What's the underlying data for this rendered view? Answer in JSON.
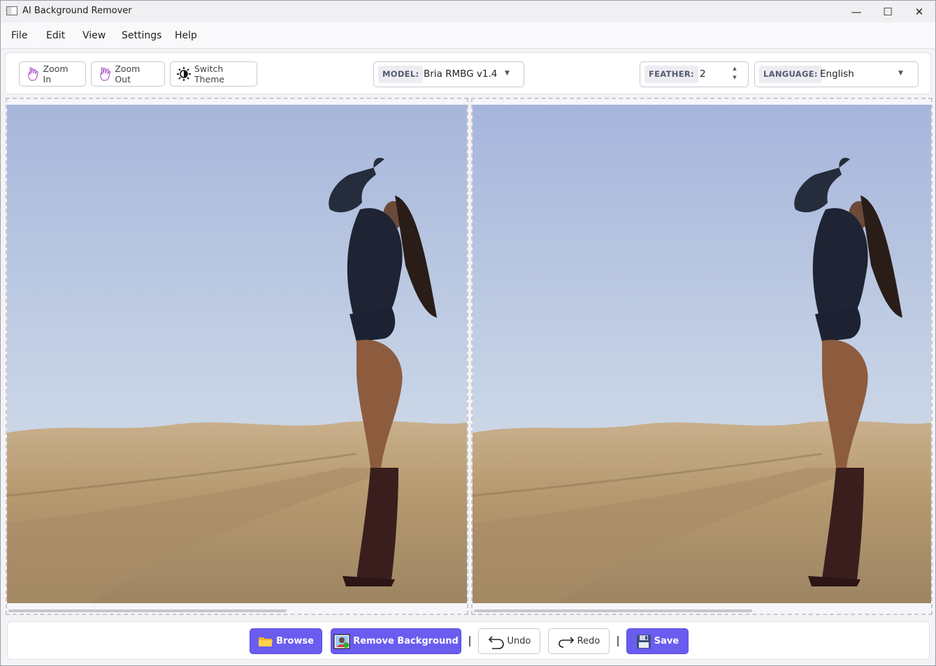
{
  "window": {
    "title": "AI Background Remover",
    "controls": {
      "minimize": "—",
      "maximize": "☐",
      "close": "✕"
    }
  },
  "menu": [
    "File",
    "Edit",
    "View",
    "Settings",
    "Help"
  ],
  "toolbar": {
    "zoom_in": "Zoom In",
    "zoom_out": "Zoom Out",
    "switch_theme": "Switch Theme",
    "model": {
      "label": "MODEL:",
      "value": "Bria RMBG v1.4"
    },
    "feather": {
      "label": "FEATHER:",
      "value": "2"
    },
    "language": {
      "label": "LANGUAGE:",
      "value": "English"
    }
  },
  "panes": {
    "original": {
      "icon": "photo-preview"
    },
    "result": {
      "icon": "photo-preview"
    }
  },
  "actions": {
    "browse": "Browse",
    "remove_background": "Remove Background",
    "undo": "Undo",
    "redo": "Redo",
    "save": "Save"
  },
  "colors": {
    "accent": "#6b5cf0",
    "sky_top": "#a9b8db",
    "sky_bottom": "#d6dee7",
    "sand": "#b8976e"
  }
}
